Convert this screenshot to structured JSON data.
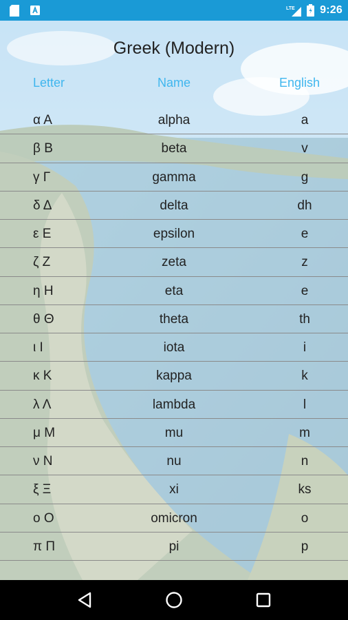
{
  "status_bar": {
    "time": "9:26",
    "network": "LTE",
    "icons": [
      "sd-card-icon",
      "app-notification-icon",
      "signal-icon",
      "battery-icon"
    ]
  },
  "page": {
    "title": "Greek (Modern)"
  },
  "columns": {
    "letter": "Letter",
    "name": "Name",
    "english": "English"
  },
  "rows": [
    {
      "letter": "α Α",
      "name": "alpha",
      "english": "a"
    },
    {
      "letter": "β Β",
      "name": "beta",
      "english": "v"
    },
    {
      "letter": "γ Γ",
      "name": "gamma",
      "english": "g"
    },
    {
      "letter": "δ Δ",
      "name": "delta",
      "english": "dh"
    },
    {
      "letter": "ε Ε",
      "name": "epsilon",
      "english": "e"
    },
    {
      "letter": "ζ Ζ",
      "name": "zeta",
      "english": "z"
    },
    {
      "letter": "η Η",
      "name": "eta",
      "english": "e"
    },
    {
      "letter": "θ Θ",
      "name": "theta",
      "english": "th"
    },
    {
      "letter": "ι Ι",
      "name": "iota",
      "english": "i"
    },
    {
      "letter": "κ Κ",
      "name": "kappa",
      "english": "k"
    },
    {
      "letter": "λ Λ",
      "name": "lambda",
      "english": "l"
    },
    {
      "letter": "μ Μ",
      "name": "mu",
      "english": "m"
    },
    {
      "letter": "ν Ν",
      "name": "nu",
      "english": "n"
    },
    {
      "letter": "ξ Ξ",
      "name": "xi",
      "english": "ks"
    },
    {
      "letter": "ο Ο",
      "name": "omicron",
      "english": "o"
    },
    {
      "letter": "π Π",
      "name": "pi",
      "english": "p"
    }
  ],
  "nav_bar": {
    "buttons": [
      "back-icon",
      "home-icon",
      "recents-icon"
    ]
  },
  "colors": {
    "status_bar": "#1a9ad6",
    "header_text": "#3fb6ee",
    "row_divider": "#8a8a8a"
  }
}
